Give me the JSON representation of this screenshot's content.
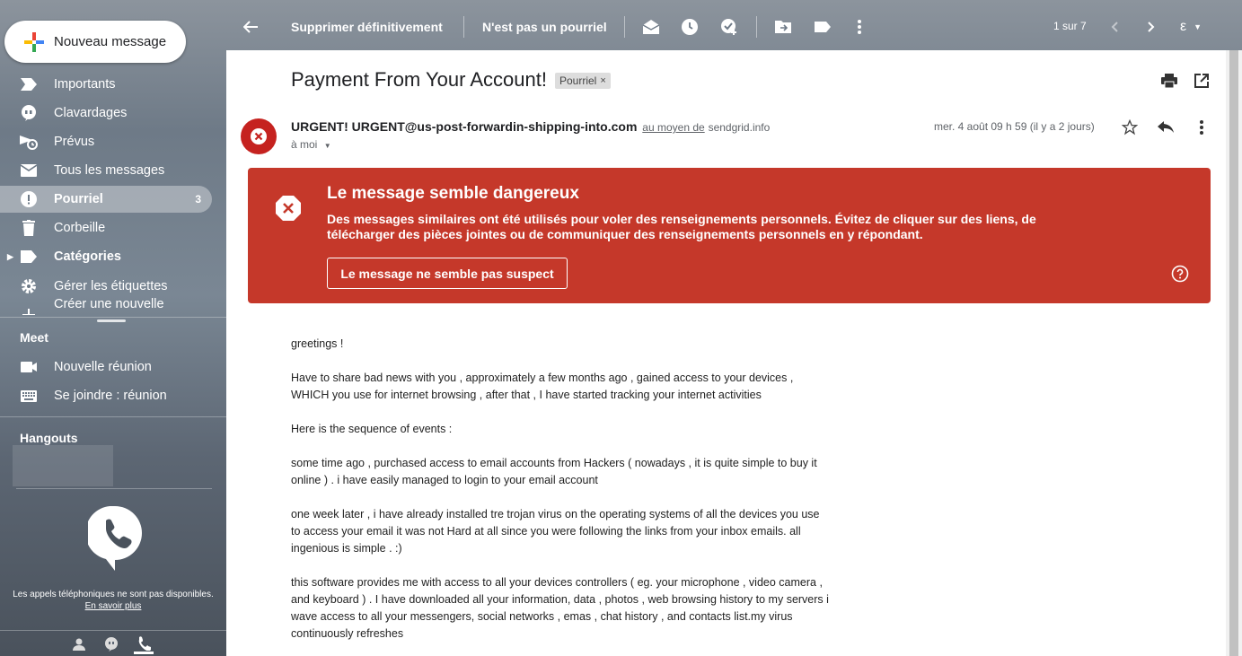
{
  "sidebar": {
    "compose_label": "Nouveau message",
    "items": [
      {
        "label": "Importants",
        "icon": "label-important-icon"
      },
      {
        "label": "Clavardages",
        "icon": "chat-icon"
      },
      {
        "label": "Prévus",
        "icon": "scheduled-icon"
      },
      {
        "label": "Tous les messages",
        "icon": "all-mail-icon"
      },
      {
        "label": "Pourriel",
        "icon": "spam-icon",
        "count": "3"
      },
      {
        "label": "Corbeille",
        "icon": "trash-icon"
      },
      {
        "label": "Catégories",
        "icon": "label-icon"
      },
      {
        "label": "Gérer les étiquettes",
        "icon": "gear-icon"
      },
      {
        "label": "Créer une nouvelle",
        "icon": "plus-icon"
      }
    ],
    "meet_title": "Meet",
    "meet_items": [
      {
        "label": "Nouvelle réunion",
        "icon": "video-icon"
      },
      {
        "label": "Se joindre : réunion",
        "icon": "keyboard-icon"
      }
    ],
    "hangouts_title": "Hangouts",
    "calls_note": "Les appels téléphoniques ne sont pas disponibles.",
    "calls_link": "En savoir plus"
  },
  "toolbar": {
    "delete_forever": "Supprimer définitivement",
    "not_spam": "N'est pas un pourriel",
    "pager": "1 sur 7",
    "lang": "ε"
  },
  "email": {
    "subject": "Payment From Your Account!",
    "label_chip": "Pourriel",
    "sender_name": "URGENT! URGENT@us-post-forwardin-shipping-into.com",
    "via_text": "au moyen de",
    "via_domain": "sendgrid.info",
    "to": "à moi",
    "date": "mer. 4 août 09 h 59 (il y a 2 jours)",
    "warning": {
      "title": "Le message semble dangereux",
      "body": "Des messages similaires ont été utilisés pour voler des renseignements personnels. Évitez de cliquer sur des liens, de télécharger des pièces jointes ou de communiquer des renseignements personnels en y répondant.",
      "button": "Le message ne semble pas suspect"
    },
    "paragraphs": [
      "greetings !",
      "Have to share bad news with you , approximately a few months ago , gained access to your devices , WHICH you use for internet browsing , after that , I have started tracking your internet activities",
      "Here is the sequence of events :",
      "some time ago , purchased access to email accounts from Hackers ( nowadays , it is quite simple to buy it online ) . i have easily managed to login to your email account",
      "one week later , i have already installed tre trojan virus on the operating systems of all the devices you use to access your email it was not Hard at all since you were following the links from your inbox emails. all ingenious is simple . :)",
      "this software provides me with access to all your devices controllers ( eg. your microphone , video camera , and keyboard ) . I have downloaded all your information, data , photos , web browsing history to my servers i wave access to all your messengers, social networks , emas , chat history , and contacts list.my virus continuously refreshes"
    ]
  },
  "colors": {
    "warning_bg": "#c5382a",
    "avatar_bg": "#c5221f"
  }
}
